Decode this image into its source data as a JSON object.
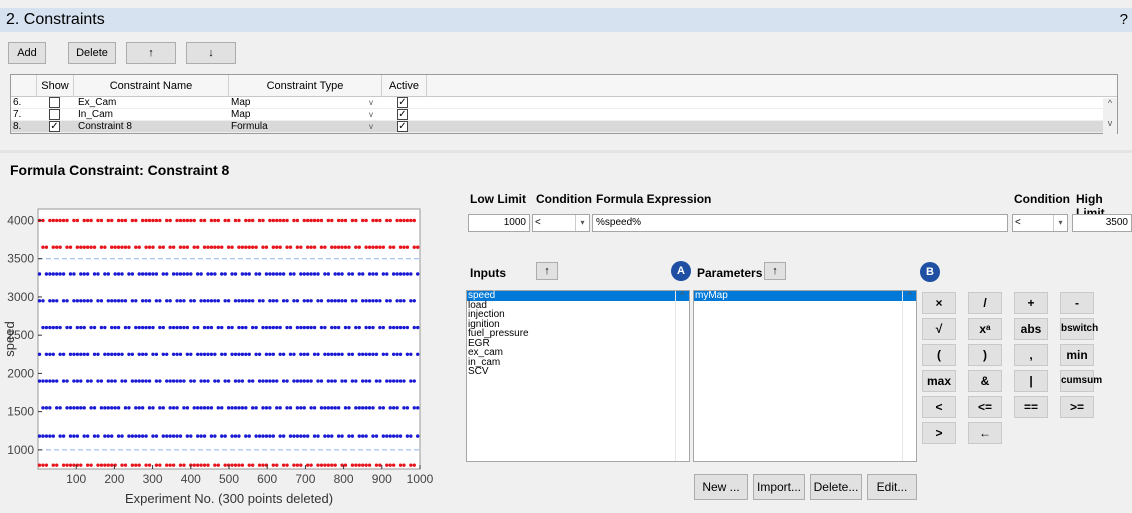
{
  "header": {
    "title": "2. Constraints",
    "help": "?"
  },
  "toolbar": {
    "add": "Add",
    "delete": "Delete",
    "up": "↑",
    "down": "↓"
  },
  "table": {
    "columns": [
      "Show",
      "Constraint Name",
      "Constraint Type",
      "Active"
    ],
    "rows": [
      {
        "index": "6.",
        "show": false,
        "name": "Ex_Cam",
        "type": "Map",
        "active": true
      },
      {
        "index": "7.",
        "show": false,
        "name": "In_Cam",
        "type": "Map",
        "active": true
      },
      {
        "index": "8.",
        "show": true,
        "name": "Constraint 8",
        "type": "Formula",
        "active": true
      }
    ]
  },
  "section_title": "Formula Constraint:  Constraint 8",
  "formula": {
    "low_limit_label": "Low Limit",
    "condition_label": "Condition",
    "expression_label": "Formula Expression",
    "condition2_label": "Condition",
    "high_limit_label": "High Limit",
    "low_limit": "1000",
    "low_cond": "<",
    "expression": "%speed%",
    "high_cond": "<",
    "high_limit": "3500"
  },
  "inputs": {
    "label": "Inputs",
    "sort": "↑",
    "items": [
      "speed",
      "load",
      "injection",
      "ignition",
      "fuel_pressure",
      "EGR",
      "ex_cam",
      "in_cam",
      "SCV"
    ],
    "selected": "speed"
  },
  "parameters": {
    "label": "Parameters",
    "sort": "↑",
    "items": [
      "myMap"
    ],
    "selected": "myMap"
  },
  "badges": {
    "a": "A",
    "b": "B"
  },
  "keypad": [
    [
      "×",
      "/",
      "+",
      "-"
    ],
    [
      "√",
      "xᵃ",
      "abs",
      "bswitch"
    ],
    [
      "(",
      ")",
      ",",
      "min"
    ],
    [
      "max",
      "&",
      "|",
      "cumsum"
    ],
    [
      "<",
      "<=",
      "==",
      ">="
    ],
    [
      ">",
      "←"
    ]
  ],
  "bottom_buttons": [
    "New ...",
    "Import...",
    "Delete...",
    "Edit..."
  ],
  "chart_data": {
    "type": "scatter",
    "xlabel": "Experiment No. (300 points deleted)",
    "ylabel": "speed",
    "xlim": [
      0,
      1000
    ],
    "ylim": [
      750,
      4150
    ],
    "xticks": [
      100,
      200,
      300,
      400,
      500,
      600,
      700,
      800,
      900,
      1000
    ],
    "yticks": [
      1000,
      1500,
      2000,
      2500,
      3000,
      3500,
      4000
    ],
    "limits": [
      1000,
      3500
    ],
    "levels": [
      4000,
      3650,
      3300,
      2950,
      2600,
      2250,
      1900,
      1550,
      1180,
      800
    ],
    "colors": {
      "violating": "#e8141c",
      "valid": "#1a1ad4",
      "limit": "#8fb2ee"
    }
  }
}
